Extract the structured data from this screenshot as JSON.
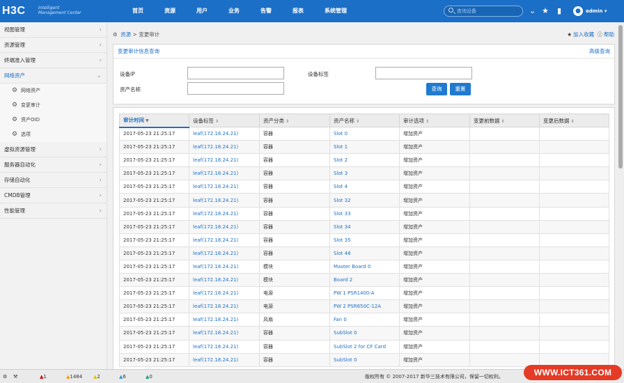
{
  "header": {
    "logo": "H3C",
    "logo_sub_1": "Intelligent",
    "logo_sub_2": "Management Center",
    "nav": [
      "首页",
      "资源",
      "用户",
      "业务",
      "告警",
      "报表",
      "系统管理"
    ],
    "search_placeholder": "查询设备",
    "user": "admin"
  },
  "sidebar": {
    "items": [
      {
        "label": "视图管理",
        "open": false
      },
      {
        "label": "资源管理",
        "open": false
      },
      {
        "label": "终端准入管理",
        "open": false
      },
      {
        "label": "网络资产",
        "open": true
      },
      {
        "label": "虚拟资源管理",
        "open": false
      },
      {
        "label": "服务器自动化",
        "open": false
      },
      {
        "label": "存储自动化",
        "open": false
      },
      {
        "label": "CMDB管理",
        "open": false
      },
      {
        "label": "性能管理",
        "open": false
      }
    ],
    "subitems": [
      "网络资产",
      "变更审计",
      "资产OID",
      "选项"
    ]
  },
  "breadcrumb": {
    "root": "资源",
    "sep": ">",
    "current": "变更审计"
  },
  "links": {
    "favorite": "加入收藏",
    "help": "帮助"
  },
  "query": {
    "title": "变更审计信息查询",
    "advanced": "高级查询",
    "ip_label": "设备IP",
    "tag_label": "设备标签",
    "asset_label": "资产名称",
    "query_btn": "查询",
    "reset_btn": "重置"
  },
  "table": {
    "headers": [
      "审计时间",
      "设备标签",
      "资产分类",
      "资产名称",
      "审计选项",
      "变更前数据",
      "变更后数据"
    ],
    "rows": [
      [
        "2017-05-23 21:25:17",
        "leaf(172.18.24.21)",
        "容器",
        "Slot 0",
        "增加资产",
        "",
        ""
      ],
      [
        "2017-05-23 21:25:17",
        "leaf(172.18.24.21)",
        "容器",
        "Slot 1",
        "增加资产",
        "",
        ""
      ],
      [
        "2017-05-23 21:25:17",
        "leaf(172.18.24.21)",
        "容器",
        "Slot 2",
        "增加资产",
        "",
        ""
      ],
      [
        "2017-05-23 21:25:17",
        "leaf(172.18.24.21)",
        "容器",
        "Slot 3",
        "增加资产",
        "",
        ""
      ],
      [
        "2017-05-23 21:25:17",
        "leaf(172.18.24.21)",
        "容器",
        "Slot 4",
        "增加资产",
        "",
        ""
      ],
      [
        "2017-05-23 21:25:17",
        "leaf(172.18.24.21)",
        "容器",
        "Slot 32",
        "增加资产",
        "",
        ""
      ],
      [
        "2017-05-23 21:25:17",
        "leaf(172.18.24.21)",
        "容器",
        "Slot 33",
        "增加资产",
        "",
        ""
      ],
      [
        "2017-05-23 21:25:17",
        "leaf(172.18.24.21)",
        "容器",
        "Slot 34",
        "增加资产",
        "",
        ""
      ],
      [
        "2017-05-23 21:25:17",
        "leaf(172.18.24.21)",
        "容器",
        "Slot 35",
        "增加资产",
        "",
        ""
      ],
      [
        "2017-05-23 21:25:17",
        "leaf(172.18.24.21)",
        "容器",
        "Slot 48",
        "增加资产",
        "",
        ""
      ],
      [
        "2017-05-23 21:25:17",
        "leaf(172.18.24.21)",
        "模块",
        "Master Board 0",
        "增加资产",
        "",
        ""
      ],
      [
        "2017-05-23 21:25:17",
        "leaf(172.18.24.21)",
        "模块",
        "Board 2",
        "增加资产",
        "",
        ""
      ],
      [
        "2017-05-23 21:25:17",
        "leaf(172.18.24.21)",
        "电源",
        "PW 1 PSR1400-A",
        "增加资产",
        "",
        ""
      ],
      [
        "2017-05-23 21:25:17",
        "leaf(172.18.24.21)",
        "电源",
        "PW 2 PSR650C-12A",
        "增加资产",
        "",
        ""
      ],
      [
        "2017-05-23 21:25:17",
        "leaf(172.18.24.21)",
        "风扇",
        "Fan 0",
        "增加资产",
        "",
        ""
      ],
      [
        "2017-05-23 21:25:17",
        "leaf(172.18.24.21)",
        "容器",
        "SubSlot 0",
        "增加资产",
        "",
        ""
      ],
      [
        "2017-05-23 21:25:17",
        "leaf(172.18.24.21)",
        "容器",
        "SubSlot 2 for CF Card",
        "增加资产",
        "",
        ""
      ],
      [
        "2017-05-23 21:25:17",
        "leaf(172.18.24.21)",
        "容器",
        "SubSlot 0",
        "增加资产",
        "",
        ""
      ]
    ]
  },
  "footer": {
    "alarm_critical": "1",
    "alarm_major": "1484",
    "alarm_minor": "2",
    "alarm_warning": "6",
    "alarm_info": "0",
    "copyright": "版权所有 © 2007-2017 新华三技术有限公司，保留一切权利。",
    "watermark": "WWW.ICT361.COM"
  }
}
